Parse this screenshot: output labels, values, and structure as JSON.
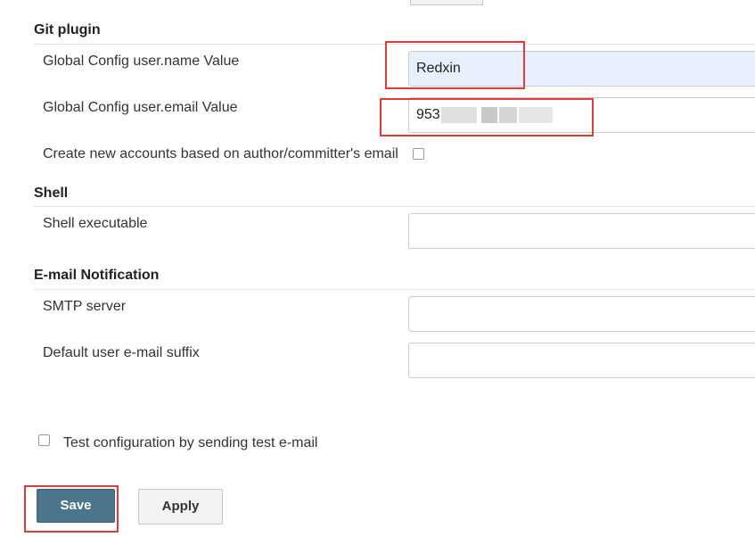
{
  "git_plugin": {
    "title": "Git plugin",
    "username_label": "Global Config user.name Value",
    "username_value": "Redxin",
    "email_label": "Global Config user.email Value",
    "email_value": "953",
    "create_accounts_label": "Create new accounts based on author/committer's email",
    "create_accounts_checked": false
  },
  "shell": {
    "title": "Shell",
    "executable_label": "Shell executable",
    "executable_value": ""
  },
  "email_notification": {
    "title": "E-mail Notification",
    "smtp_label": "SMTP server",
    "smtp_value": "",
    "suffix_label": "Default user e-mail suffix",
    "suffix_value": ""
  },
  "test_config": {
    "label": "Test configuration by sending test e-mail",
    "checked": false
  },
  "actions": {
    "save_label": "Save",
    "apply_label": "Apply"
  },
  "colors": {
    "save_button": "#4b758b",
    "highlight": "#e03a3a",
    "autofill_background": "#e8f0fe"
  }
}
